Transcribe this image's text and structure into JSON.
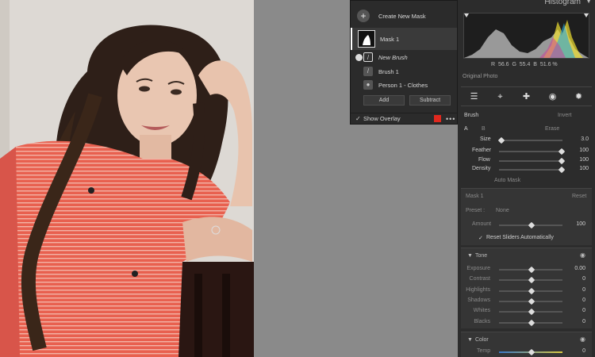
{
  "masks_panel": {
    "create_label": "Create New Mask",
    "mask_label": "Mask 1",
    "new_brush_label": "New Brush",
    "brush1_label": "Brush 1",
    "person_label": "Person 1 - Clothes",
    "add_label": "Add",
    "subtract_label": "Subtract",
    "show_overlay_label": "Show Overlay",
    "overlay_color": "#e0281e",
    "more_glyph": "•••"
  },
  "histogram": {
    "title": "Histogram",
    "readout": "R  56.6  G  55.4  B  51.6 %",
    "original_photo_label": "Original Photo"
  },
  "brush": {
    "title": "Brush",
    "invert_label": "Invert",
    "a_label": "A",
    "b_label": "B",
    "erase_label": "Erase",
    "size_label": "Size",
    "size_value": "3.0",
    "feather_label": "Feather",
    "feather_value": "100",
    "flow_label": "Flow",
    "flow_value": "100",
    "density_label": "Density",
    "density_value": "100",
    "auto_mask_label": "Auto Mask"
  },
  "mask_settings": {
    "title": "Mask 1",
    "reset_label": "Reset",
    "preset_label": "Preset :",
    "preset_value": "None",
    "amount_label": "Amount",
    "amount_value": "100",
    "reset_sliders_label": "Reset Sliders Automatically"
  },
  "tone": {
    "title": "Tone",
    "rows": [
      {
        "label": "Exposure",
        "value": "0.00"
      },
      {
        "label": "Contrast",
        "value": "0"
      },
      {
        "label": "Highlights",
        "value": "0"
      },
      {
        "label": "Shadows",
        "value": "0"
      },
      {
        "label": "Whites",
        "value": "0"
      },
      {
        "label": "Blacks",
        "value": "0"
      }
    ]
  },
  "color": {
    "title": "Color",
    "temp_label": "Temp",
    "temp_value": "0"
  }
}
